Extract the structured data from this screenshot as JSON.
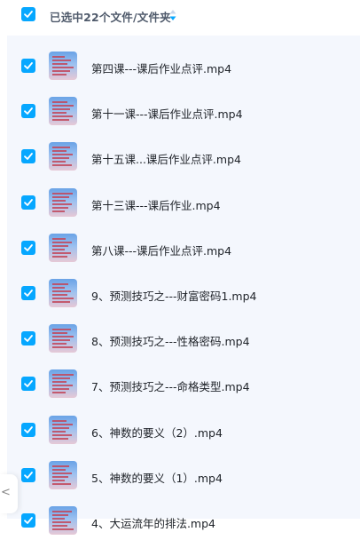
{
  "header": {
    "selection_label": "已选中22个文件/文件夹"
  },
  "files": [
    {
      "name": "第四课---课后作业点评.mp4"
    },
    {
      "name": "第十一课---课后作业点评.mp4"
    },
    {
      "name": "第十五课...课后作业点评.mp4"
    },
    {
      "name": "第十三课---课后作业.mp4"
    },
    {
      "name": "第八课---课后作业点评.mp4"
    },
    {
      "name": "9、预测技巧之---财富密码1.mp4"
    },
    {
      "name": "8、预测技巧之---性格密码.mp4"
    },
    {
      "name": "7、预测技巧之---命格类型.mp4"
    },
    {
      "name": "6、神数的要义（2）.mp4"
    },
    {
      "name": "5、神数的要义（1）.mp4"
    },
    {
      "name": "4、大运流年的排法.mp4"
    }
  ],
  "side_tab": {
    "glyph": "<"
  },
  "colors": {
    "checkbox": "#06a7ff",
    "list_background": "#f4f7fd"
  }
}
